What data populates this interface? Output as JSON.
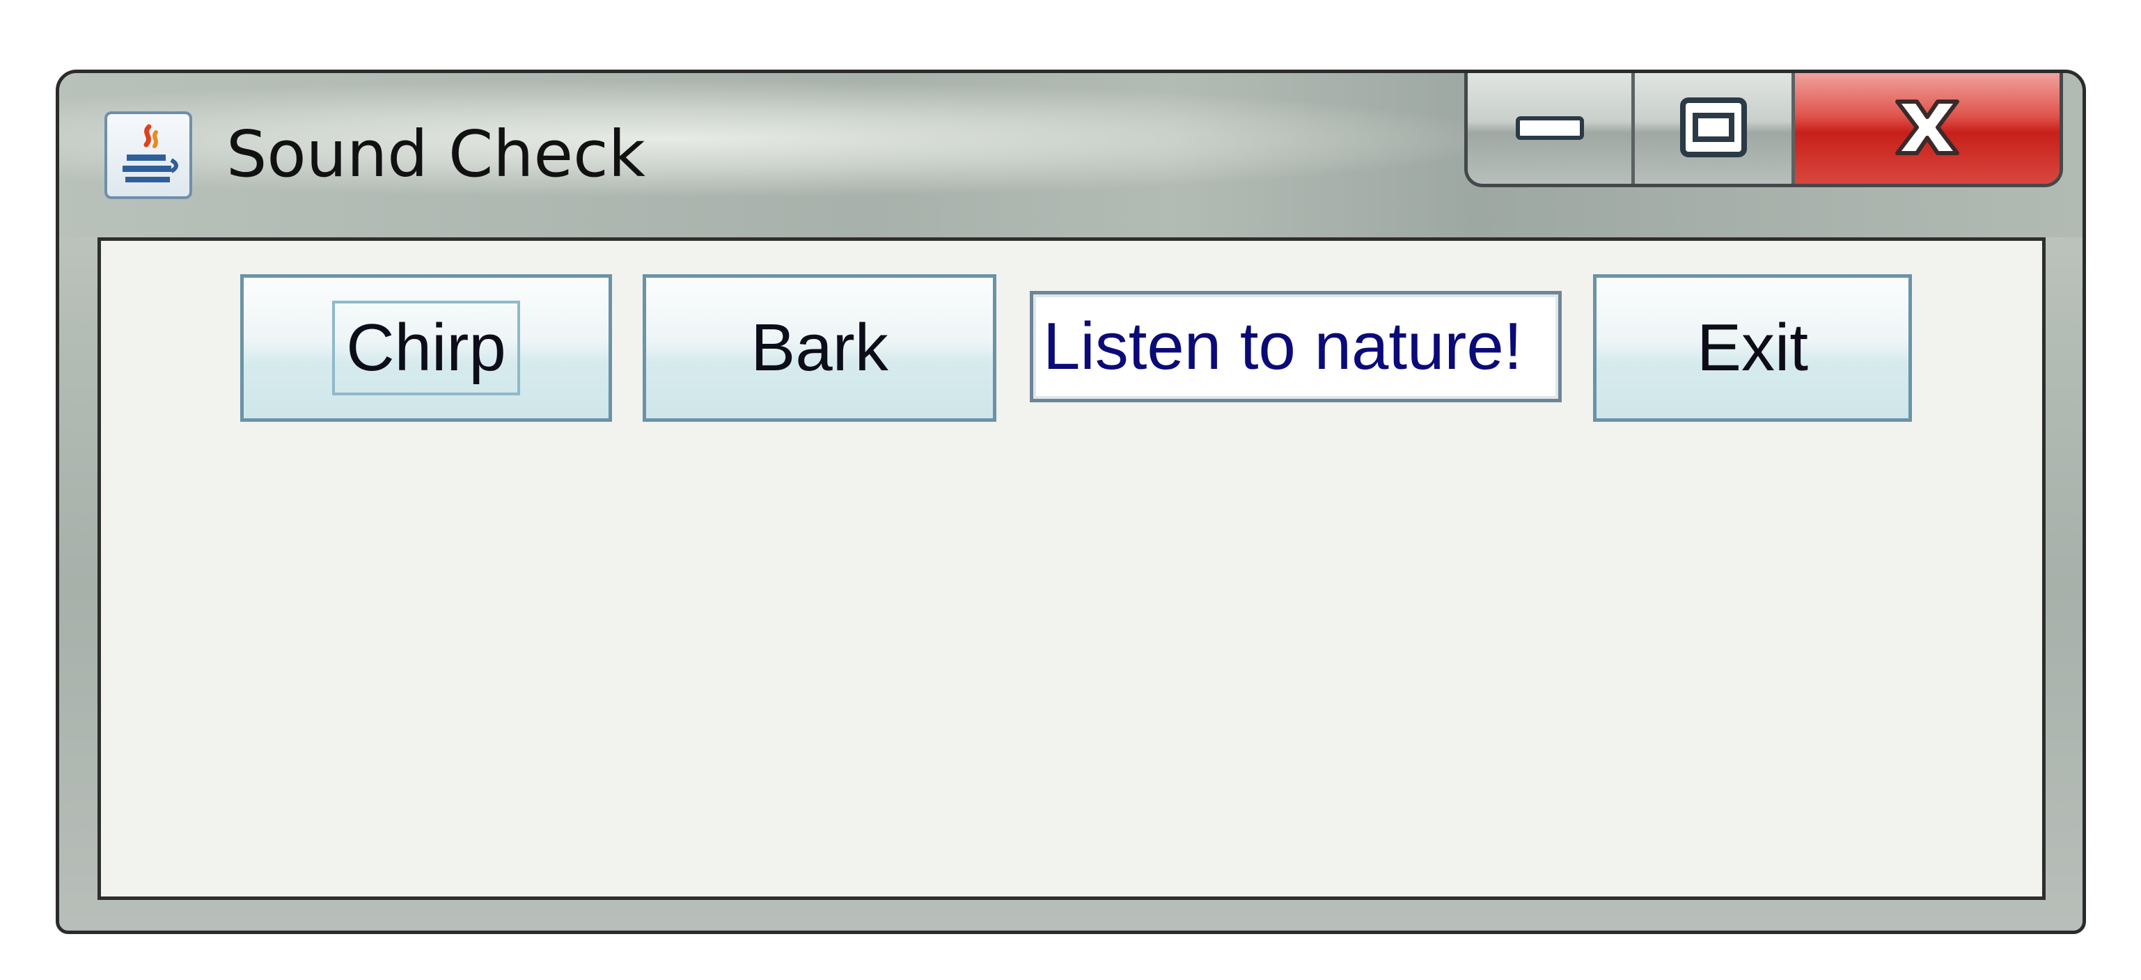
{
  "window": {
    "title": "Sound Check",
    "icons": {
      "app": "java-cup-icon",
      "minimize": "minimize-icon",
      "maximize": "maximize-icon",
      "close": "close-icon"
    }
  },
  "toolbar": {
    "chirp_label": "Chirp",
    "bark_label": "Bark",
    "message": "Listen to nature!",
    "exit_label": "Exit"
  },
  "colors": {
    "close_button": "#c8201a",
    "button_border": "#6a93a8",
    "field_text": "#0a0a78",
    "content_background": "#f2f2ee"
  }
}
